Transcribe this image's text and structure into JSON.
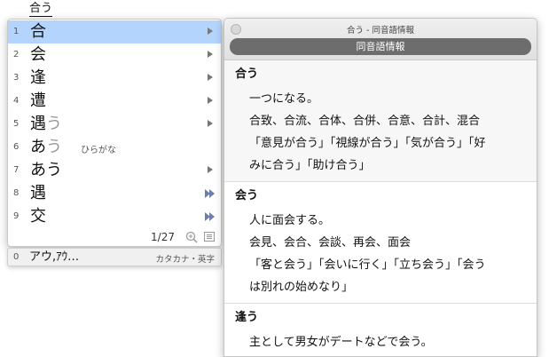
{
  "input_text": "合う",
  "candidates": [
    {
      "num": "1",
      "word": "合",
      "okuri": "",
      "annotation": "",
      "indicator": "arrow",
      "selected": true
    },
    {
      "num": "2",
      "word": "会",
      "okuri": "",
      "annotation": "",
      "indicator": "arrow"
    },
    {
      "num": "3",
      "word": "逢",
      "okuri": "",
      "annotation": "",
      "indicator": "arrow"
    },
    {
      "num": "4",
      "word": "遭",
      "okuri": "",
      "annotation": "",
      "indicator": "arrow"
    },
    {
      "num": "5",
      "word": "遇",
      "okuri": "う",
      "annotation": "",
      "indicator": "arrow"
    },
    {
      "num": "6",
      "word": "あ",
      "okuri": "う",
      "annotation": "ひらがな",
      "indicator": ""
    },
    {
      "num": "7",
      "word": "あう",
      "okuri": "",
      "annotation": "",
      "indicator": "arrow"
    },
    {
      "num": "8",
      "word": "遇",
      "okuri": "",
      "annotation": "",
      "indicator": "double-arrow"
    },
    {
      "num": "9",
      "word": "交",
      "okuri": "",
      "annotation": "",
      "indicator": "double-arrow"
    }
  ],
  "pager": "1/27",
  "footer_icons": [
    "zoom-in-icon",
    "list-icon"
  ],
  "extra_candidate": {
    "num": "0",
    "word": "アウ,ｱｳ…",
    "annotation": "カタカナ・英字"
  },
  "info": {
    "title": "合う - 同音語情報",
    "tab": "同音語情報",
    "entries": [
      {
        "head": "合う",
        "lines": [
          "一つになる。",
          "合致、合流、合体、合併、合意、合計、混合",
          "「意見が合う」「視線が合う」「気が合う」「好",
          "みに合う」「助け合う」"
        ]
      },
      {
        "head": "会う",
        "lines": [
          "人に面会する。",
          "会見、会合、会談、再会、面会",
          "「客と会う」「会いに行く」「立ち会う」「会う",
          "は別れの始めなり」"
        ]
      },
      {
        "head": "逢う",
        "lines": [
          "主として男女がデートなどで会う。"
        ]
      }
    ]
  },
  "colors": {
    "selection": "#b3d4fc",
    "tab_bg": "#6d6d6d",
    "okurigana": "#999999"
  }
}
